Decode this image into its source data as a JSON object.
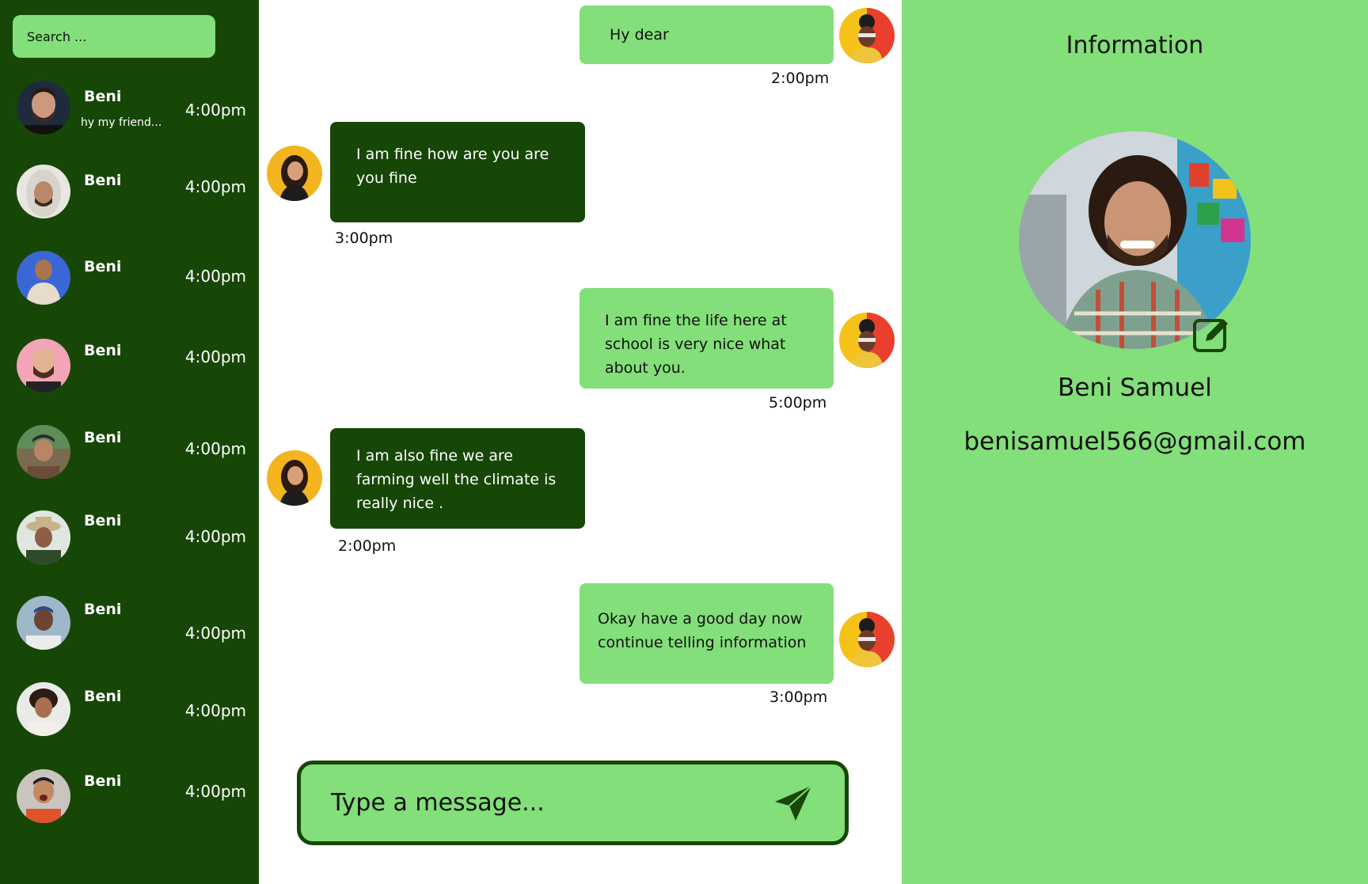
{
  "colors": {
    "dark_green": "#174707",
    "light_green": "#83df79",
    "white": "#ffffff"
  },
  "sidebar": {
    "search_placeholder": "Search ...",
    "contacts": [
      {
        "name": "Beni",
        "preview": "hy my friend...",
        "time": "4:00pm"
      },
      {
        "name": "Beni",
        "time": "4:00pm"
      },
      {
        "name": "Beni",
        "time": "4:00pm"
      },
      {
        "name": "Beni",
        "time": "4:00pm"
      },
      {
        "name": "Beni",
        "time": "4:00pm"
      },
      {
        "name": "Beni",
        "time": "4:00pm"
      },
      {
        "name": "Beni",
        "time": "4:00pm"
      },
      {
        "name": "Beni",
        "time": "4:00pm"
      },
      {
        "name": "Beni",
        "time": "4:00pm"
      }
    ]
  },
  "chat": {
    "messages": [
      {
        "direction": "outgoing",
        "text": "Hy dear",
        "time": "2:00pm"
      },
      {
        "direction": "incoming",
        "text": "I am fine how are you are you fine",
        "time": "3:00pm"
      },
      {
        "direction": "outgoing",
        "text": "I am fine the life here at school is very nice what about you.",
        "time": "5:00pm"
      },
      {
        "direction": "incoming",
        "text": "I am also fine we are farming well the climate is really nice .",
        "time": "2:00pm"
      },
      {
        "direction": "outgoing",
        "text": "Okay have a good day now continue telling information",
        "time": "3:00pm"
      }
    ],
    "composer_placeholder": "Type a message...",
    "send_icon": "send-icon"
  },
  "info": {
    "title": "Information",
    "name": "Beni Samuel",
    "email": "benisamuel566@gmail.com",
    "edit_icon": "edit-icon"
  }
}
